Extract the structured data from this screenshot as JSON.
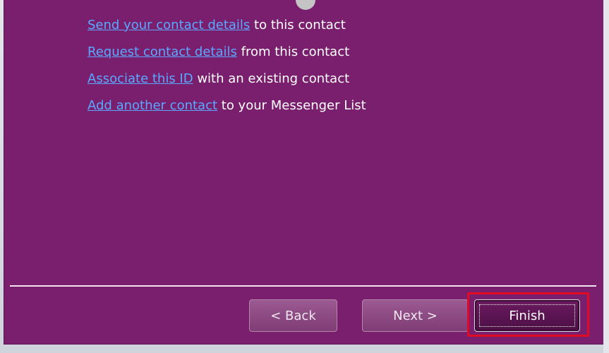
{
  "content": {
    "links": [
      {
        "link": "Send your contact details",
        "rest": " to this contact"
      },
      {
        "link": "Request contact details",
        "rest": " from this contact"
      },
      {
        "link": "Associate this ID",
        "rest": " with an existing contact"
      },
      {
        "link": "Add another contact",
        "rest": " to your Messenger List"
      }
    ]
  },
  "footer": {
    "back_label": "< Back",
    "next_label": "Next >",
    "finish_label": "Finish"
  },
  "colors": {
    "window_bg": "#7a1f6e",
    "link": "#5aa8ff",
    "highlight": "#e00b22"
  }
}
